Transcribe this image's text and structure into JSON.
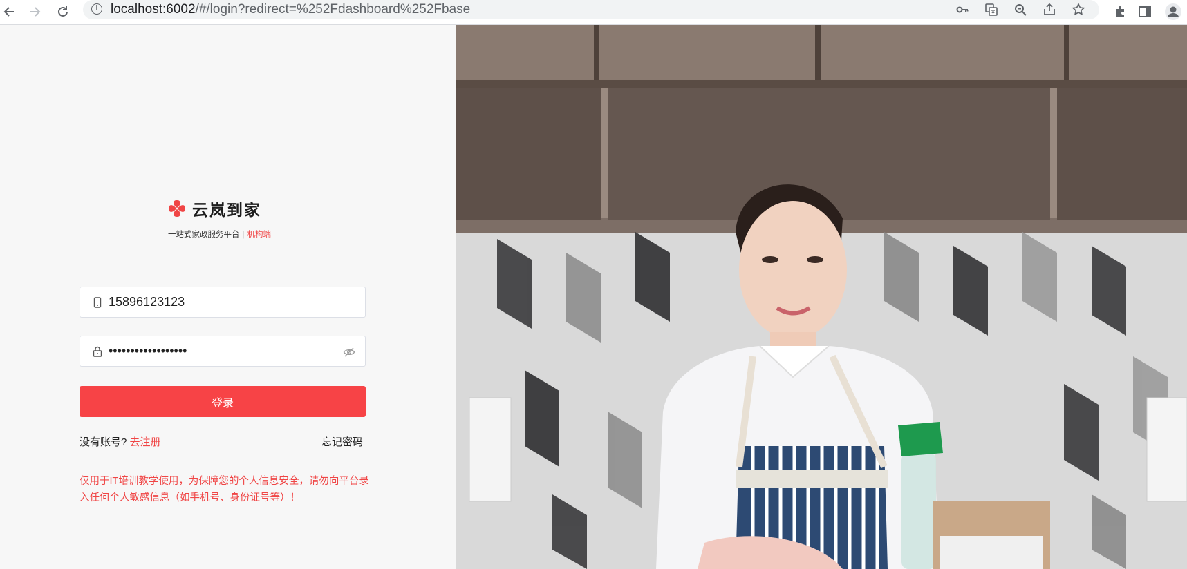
{
  "browser": {
    "url_host": "localhost:6002",
    "url_path": "/#/login?redirect=%252Fdashboard%252Fbase"
  },
  "brand": {
    "name": "云岚到家",
    "tagline": "一站式家政服务平台",
    "separator": "|",
    "role": "机构端",
    "logo_color": "#f04545"
  },
  "login": {
    "phone_value": "15896123123",
    "password_value": "••••••••••••••••••",
    "submit_label": "登录",
    "no_account_text": "没有账号?",
    "register_link": "去注册",
    "forgot_link": "忘记密码",
    "notice": "仅用于IT培训教学使用，为保障您的个人信息安全，请勿向平台录入任何个人敏感信息（如手机号、身份证号等）！",
    "accent_color": "#f74346"
  }
}
